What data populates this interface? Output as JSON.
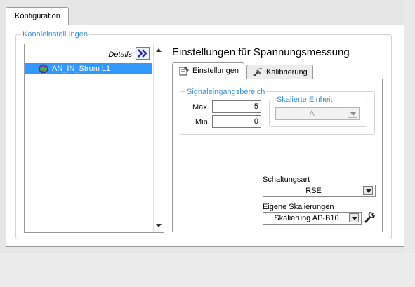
{
  "tabs": {
    "konfiguration": "Konfiguration"
  },
  "channel_settings": {
    "legend": "Kanaleinstellungen",
    "details_label": "Details",
    "details_button_icon": "double-chevron-right-icon",
    "channels": [
      {
        "name": "AN_IN_Strom L1",
        "icon": "globe-channel-icon",
        "selected": true
      }
    ]
  },
  "measurement": {
    "title": "Einstellungen für Spannungsmessung",
    "tabs": {
      "einstellungen": "Einstellungen",
      "kalibrierung": "Kalibrierung"
    },
    "signal_range": {
      "legend": "Signaleingangsbereich",
      "max_label": "Max.",
      "max_value": "5",
      "min_label": "Min.",
      "min_value": "0"
    },
    "scaled_unit": {
      "legend": "Skalierte Einheit",
      "value": "A"
    },
    "wiring": {
      "label": "Schaltungsart",
      "value": "RSE"
    },
    "custom_scaling": {
      "label": "Eigene Skalierungen",
      "value": "Skalierung AP-B10",
      "edit_icon": "wrench-icon"
    }
  },
  "colors": {
    "accent_legend": "#3a8fd6",
    "selection": "#3399ff",
    "details_button": "#1a2f9c"
  }
}
